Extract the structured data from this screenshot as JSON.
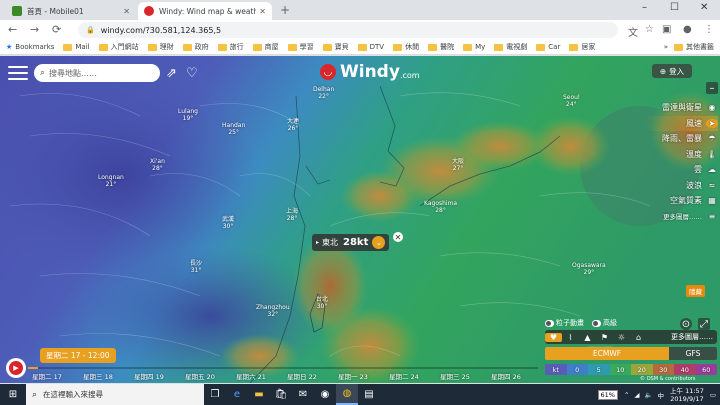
{
  "browser": {
    "tabs": [
      {
        "title": "首頁 - Mobile01",
        "favicon_color": "#3a8a2a",
        "favicon_letter": "01"
      },
      {
        "title": "Windy: Wind map & weather fo",
        "favicon_color": "#d8262b",
        "favicon_letter": "W"
      }
    ],
    "new_tab": "+",
    "window_controls": {
      "minimize": "–",
      "maximize": "☐",
      "close": "✕"
    },
    "address": "windy.com/?30.581,124.365,5",
    "nav": {
      "back": "←",
      "forward": "→",
      "reload": "⟳"
    },
    "toolbar_icons": [
      "translate-icon",
      "star-icon",
      "extension-icon",
      "account-icon",
      "menu-icon"
    ],
    "bookmarks": [
      "Bookmarks",
      "Mail",
      "入門網站",
      "理財",
      "政府",
      "旅行",
      "商屋",
      "學習",
      "寶貝",
      "DTV",
      "休閒",
      "醫院",
      "My",
      "電視劇",
      "Car",
      "居家"
    ],
    "bookmarks_more": "»",
    "other_bookmarks": "其他書籤"
  },
  "map": {
    "search_placeholder": "搜尋地點……",
    "logo_text": "Windy",
    "logo_suffix": ".com",
    "login_label": "登入",
    "layers": [
      {
        "label": "雷達與衛星",
        "icon": "◉"
      },
      {
        "label": "風速",
        "icon": "➤",
        "active": true
      },
      {
        "label": "降雨、雷暴",
        "icon": "☂"
      },
      {
        "label": "溫度",
        "icon": "🌡"
      },
      {
        "label": "雲",
        "icon": "☁"
      },
      {
        "label": "波浪",
        "icon": "≈"
      },
      {
        "label": "空氣質素",
        "icon": "▦"
      },
      {
        "label": "更多圖層……",
        "icon": "≡"
      }
    ],
    "marker": {
      "direction": "東北",
      "speed": "28kt"
    },
    "cities": [
      {
        "name": "Delhan",
        "temp": "22°"
      },
      {
        "name": "大連",
        "temp": "26°"
      },
      {
        "name": "Seoul",
        "temp": "24°"
      },
      {
        "name": "Lulang",
        "temp": "19°"
      },
      {
        "name": "Handan",
        "temp": "25°"
      },
      {
        "name": "Xi'an",
        "temp": "28°"
      },
      {
        "name": "Longnan",
        "temp": "21°"
      },
      {
        "name": "Kagoshima",
        "temp": "28°"
      },
      {
        "name": "大阪",
        "temp": "27°"
      },
      {
        "name": "Ogasawara",
        "temp": "29°"
      },
      {
        "name": "Zhangzhou",
        "temp": "32°"
      },
      {
        "name": "台北",
        "temp": "30°"
      },
      {
        "name": "長沙",
        "temp": "31°"
      },
      {
        "name": "武漢",
        "temp": "30°"
      },
      {
        "name": "上海",
        "temp": "28°"
      }
    ],
    "overlay_options": [
      "粒子動畫",
      "高級"
    ],
    "more_layers": "更多圖層……",
    "model": {
      "primary": "ECMWF",
      "secondary": "GFS"
    },
    "legend": {
      "unit": "kt",
      "values": [
        "0",
        "5",
        "10",
        "20",
        "30",
        "40",
        "60"
      ],
      "colors": [
        "#5a5db8",
        "#3f7ec8",
        "#2e9ab0",
        "#3aa95c",
        "#9aa63c",
        "#b46a3c",
        "#b13c6a",
        "#9a3c9a"
      ]
    },
    "copyright": "© OSM & contributors",
    "orange_tag": "隱藏",
    "time_badge": "星期二 17 - 12:00",
    "timeline_days": [
      "星期二 17",
      "星期三 18",
      "星期四 19",
      "星期五 20",
      "星期六 21",
      "星期日 22",
      "星期一 23",
      "星期二 24",
      "星期三 25",
      "星期四 26"
    ],
    "timeline_progress": 0.02
  },
  "taskbar": {
    "search_placeholder": "在這裡輸入來搜尋",
    "battery": "61%",
    "time": "上午 11:57",
    "date": "2019/9/17"
  }
}
